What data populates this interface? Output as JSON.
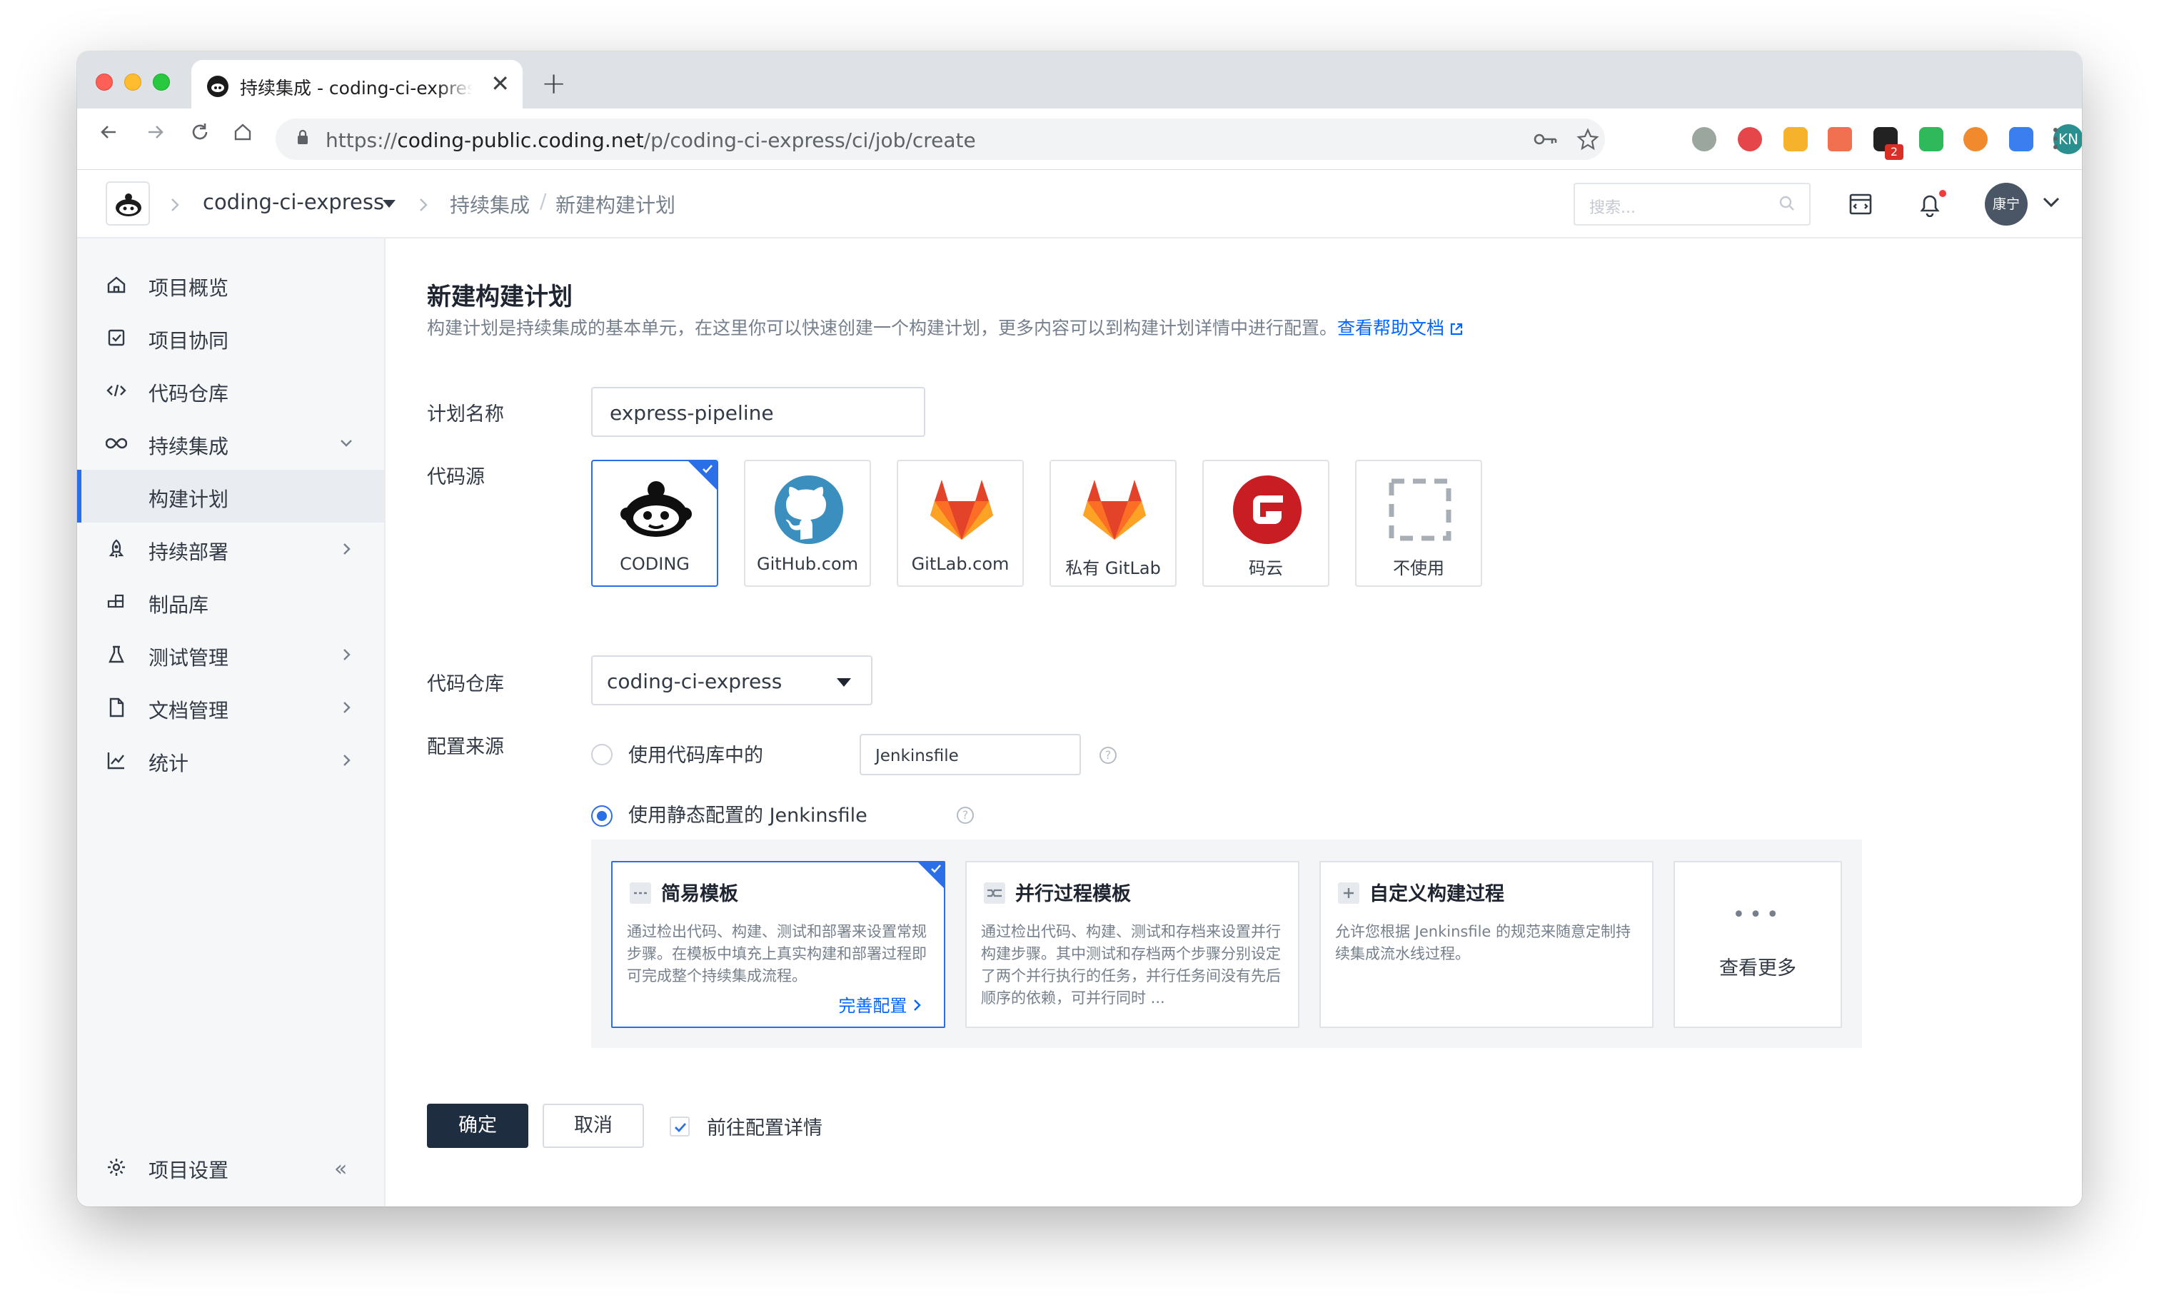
{
  "browser": {
    "tab_title": "持续集成 - coding-ci-express - CODING",
    "new_tab": "+",
    "close_tab": "✕",
    "url_prefix": "https://",
    "url_host": "coding-public.coding.net",
    "url_path": "/p/coding-ci-express/ci/job/create",
    "extension_badge": "2",
    "profile_initials": "KN"
  },
  "header": {
    "project_name": "coding-ci-express",
    "breadcrumb_ci": "持续集成",
    "breadcrumb_current": "新建构建计划",
    "search_placeholder": "搜索...",
    "user_name": "康宁"
  },
  "sidebar": {
    "items": [
      {
        "label": "项目概览",
        "icon": "home-icon"
      },
      {
        "label": "项目协同",
        "icon": "checkbox-icon"
      },
      {
        "label": "代码仓库",
        "icon": "code-icon"
      },
      {
        "label": "持续集成",
        "icon": "infinity-icon"
      },
      {
        "label": "构建计划",
        "icon": ""
      },
      {
        "label": "持续部署",
        "icon": "rocket-icon"
      },
      {
        "label": "制品库",
        "icon": "blocks-icon"
      },
      {
        "label": "测试管理",
        "icon": "flask-icon"
      },
      {
        "label": "文档管理",
        "icon": "document-icon"
      },
      {
        "label": "统计",
        "icon": "chart-icon"
      }
    ],
    "settings_label": "项目设置",
    "collapse": "«"
  },
  "page": {
    "title": "新建构建计划",
    "description": "构建计划是持续集成的基本单元，在这里你可以快速创建一个构建计划，更多内容可以到构建计划详情中进行配置。",
    "help_link": "查看帮助文档",
    "label_name": "计划名称",
    "name_value": "express-pipeline",
    "label_source": "代码源",
    "sources": [
      {
        "label": "CODING",
        "selected": true
      },
      {
        "label": "GitHub.com",
        "selected": false
      },
      {
        "label": "GitLab.com",
        "selected": false
      },
      {
        "label": "私有 GitLab",
        "selected": false
      },
      {
        "label": "码云",
        "selected": false
      },
      {
        "label": "不使用",
        "selected": false
      }
    ],
    "label_repo": "代码仓库",
    "repo_value": "coding-ci-express",
    "label_config": "配置来源",
    "radio_repo_label": "使用代码库中的",
    "jenkinsfile_value": "Jenkinsfile",
    "radio_static_label": "使用静态配置的 Jenkinsfile",
    "help_q": "?",
    "templates": [
      {
        "title": "简易模板",
        "desc": "通过检出代码、构建、测试和部署来设置常规步骤。在模板中填充上真实构建和部署过程即可完成整个持续集成流程。",
        "link": "完善配置",
        "selected": true
      },
      {
        "title": "并行过程模板",
        "desc": "通过检出代码、构建、测试和存档来设置并行构建步骤。其中测试和存档两个步骤分别设定了两个并行执行的任务，并行任务间没有先后顺序的依赖，可并行同时 ...",
        "selected": false
      },
      {
        "title": "自定义构建过程",
        "desc": "允许您根据 Jenkinsfile 的规范来随意定制持续集成流水线过程。",
        "selected": false
      }
    ],
    "more_dots": "•••",
    "more_label": "查看更多",
    "confirm": "确定",
    "cancel": "取消",
    "goto_detail": "前往配置详情"
  },
  "colors": {
    "accent": "#2a6ee8",
    "link": "#0066ff",
    "primary_button": "#1f2d40"
  }
}
